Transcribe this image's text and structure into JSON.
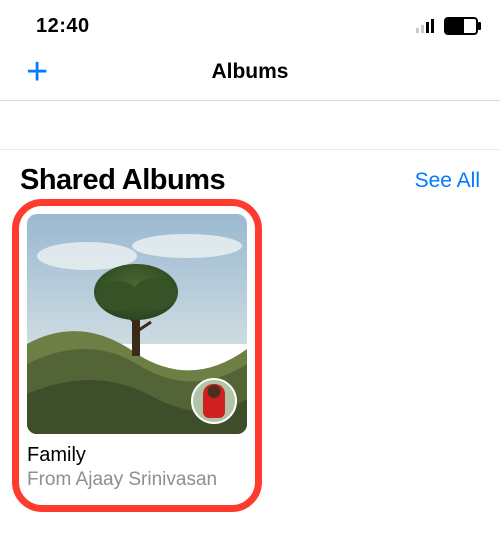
{
  "status_bar": {
    "time": "12:40"
  },
  "nav": {
    "add_glyph": "+",
    "title": "Albums"
  },
  "section": {
    "title": "Shared Albums",
    "see_all": "See All"
  },
  "albums": [
    {
      "name": "Family",
      "from": "From Ajaay Srinivasan"
    }
  ],
  "accent": "#007aff",
  "highlight": "#ff3b30"
}
